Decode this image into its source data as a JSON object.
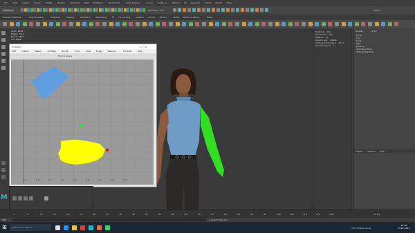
{
  "menus": [
    "File",
    "Edit",
    "Create",
    "Select",
    "Modify",
    "Display",
    "Windows",
    "Mesh",
    "Edit Mesh",
    "Mesh Tools",
    "Mesh Display",
    "Curves",
    "Surfaces",
    "Deform",
    "UV",
    "Generate",
    "Cache",
    "Arnold",
    "Help"
  ],
  "workspace_label": "Modeling",
  "select_label": "Symmetry: Off",
  "signin_label": "Sign In",
  "shelf_tabs": [
    "Curves / Surfaces",
    "Poly Modeling",
    "Sculpting",
    "Rigging",
    "Animation",
    "Rendering",
    "FX",
    "FX Caching",
    "Custom",
    "Arnold",
    "Bifrost",
    "MASH",
    "Motion Graphics",
    "XGen"
  ],
  "uv_window_title": "UV Editor",
  "uv_menus": [
    "Edit",
    "Create",
    "Select",
    "Cut/Sew",
    "Modify",
    "Tools",
    "View",
    "Image",
    "Textures",
    "UV Sets",
    "Help"
  ],
  "uv_caption": "Flip UV shells",
  "uv_axis_labels": [
    "0.1",
    "0.2",
    "0.3",
    "0.4",
    "0.5",
    "0.6",
    "0.7",
    "0.8",
    "0.9"
  ],
  "hud_rows": [
    {
      "label": "Verts:",
      "value": "3626"
    },
    {
      "label": "Edges:",
      "value": "7112"
    },
    {
      "label": "Faces:",
      "value": "3483"
    },
    {
      "label": "Tris:",
      "value": "6896"
    },
    {
      "label": "UVs:",
      "value": "3847"
    }
  ],
  "right_stats": [
    {
      "label": "Backfaces:",
      "value": "N/A"
    },
    {
      "label": "Smoothness:",
      "value": "N/A"
    },
    {
      "label": "Instance:",
      "value": "No"
    },
    {
      "label": "Display Layer:",
      "value": "default"
    },
    {
      "label": "Distance From Camera:",
      "value": "34.47"
    },
    {
      "label": "Selected Objects:",
      "value": "1"
    }
  ],
  "bottom_stats": [
    {
      "label": "Frame:",
      "value": "1"
    },
    {
      "label": "Subdivs:",
      "value": "N/A"
    },
    {
      "label": "Pos:",
      "value": "N/A"
    }
  ],
  "outliner_items": [
    "persp",
    "top",
    "front",
    "side",
    "pCube1",
    "defaultLightSet",
    "defaultObjectSet"
  ],
  "outliner_tabs": [
    "Display",
    "Anim"
  ],
  "layer_tabs": [
    "Layers",
    "Options",
    "Help"
  ],
  "fps_label": "24 fps",
  "cmd_label": "MEL",
  "result_label": "// Result: Flip UVs",
  "search_label": "Type here to search",
  "weather": "23°C Mostly sunny",
  "clock_time": "10:20",
  "clock_date": "13-07-2021",
  "timeline_ticks": [
    "1",
    "5",
    "10",
    "15",
    "20",
    "25",
    "30",
    "35",
    "40",
    "45",
    "50",
    "55",
    "60",
    "65",
    "70",
    "75",
    "80",
    "85",
    "90",
    "95",
    "100",
    "105",
    "110",
    "115",
    "120"
  ],
  "colors": {
    "accent": "#5fa8e8",
    "uv_blue": "#5a9ee8",
    "uv_yellow": "#ffff00",
    "green": "#33dd22",
    "red": "#dd1111"
  }
}
